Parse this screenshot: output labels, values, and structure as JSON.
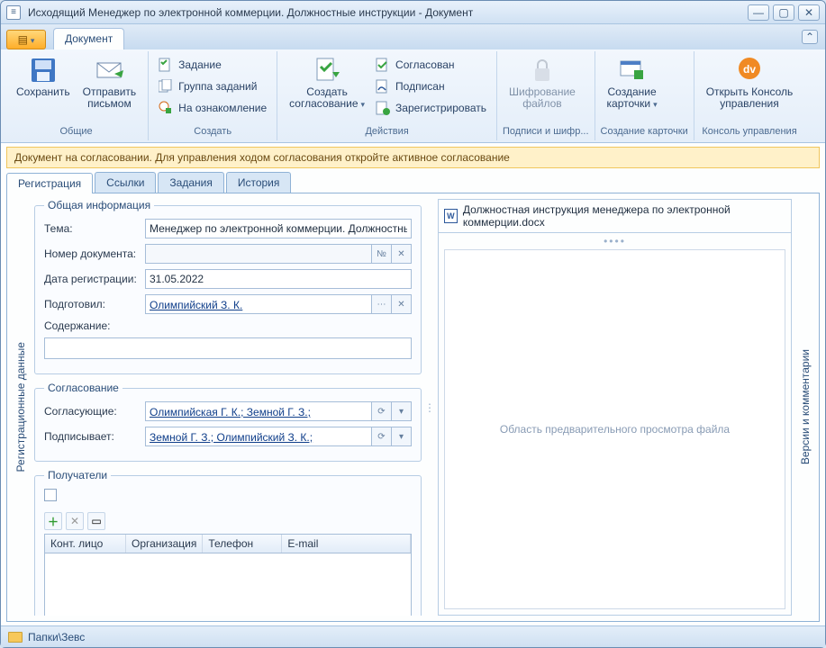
{
  "title": "Исходящий Менеджер по электронной коммерции. Должностные инструкции - Документ",
  "ribbon_tabs": {
    "document": "Документ"
  },
  "ribbon": {
    "groups": {
      "common": "Общие",
      "create": "Создать",
      "actions": "Действия",
      "sign": "Подписи и шифр...",
      "card": "Создание карточки",
      "console": "Консоль управления"
    },
    "save": "Сохранить",
    "send_letter": "Отправить\nписьмом",
    "task": "Задание",
    "task_group": "Группа заданий",
    "for_review": "На ознакомление",
    "create_approval": "Создать\nсогласование",
    "approved": "Согласован",
    "signed": "Подписан",
    "register": "Зарегистрировать",
    "encrypt": "Шифрование\nфайлов",
    "create_card": "Создание\nкарточки",
    "open_console": "Открыть Консоль\nуправления"
  },
  "infobar": "Документ на согласовании. Для управления ходом согласования откройте активное согласование",
  "tabs": {
    "registration": "Регистрация",
    "links": "Ссылки",
    "tasks": "Задания",
    "history": "История"
  },
  "side_left": "Регистрационные данные",
  "side_right": "Версии и комментарии",
  "sections": {
    "general": "Общая информация",
    "approval": "Согласование",
    "recipients": "Получатели"
  },
  "fields": {
    "subject_label": "Тема:",
    "subject_value": "Менеджер по электронной коммерции. Должностные",
    "docnum_label": "Номер документа:",
    "docnum_btn": "№",
    "regdate_label": "Дата регистрации:",
    "regdate_value": "31.05.2022",
    "prepared_label": "Подготовил:",
    "prepared_value": "Олимпийский З. К.",
    "content_label": "Содержание:",
    "approvers_label": "Согласующие:",
    "approvers_value": "Олимпийская Г. К.; Земной Г. З.; ",
    "signer_label": "Подписывает:",
    "signer_value": "Земной Г. З.; Олимпийский З. К.; "
  },
  "grid": {
    "cols": {
      "contact": "Конт. лицо",
      "org": "Организация",
      "tel": "Телефон",
      "email": "E-mail"
    }
  },
  "preview": {
    "filename": "Должностная инструкция менеджера по электронной коммерции.docx",
    "placeholder": "Область предварительного просмотра файла"
  },
  "statusbar": "Папки\\Зевс"
}
